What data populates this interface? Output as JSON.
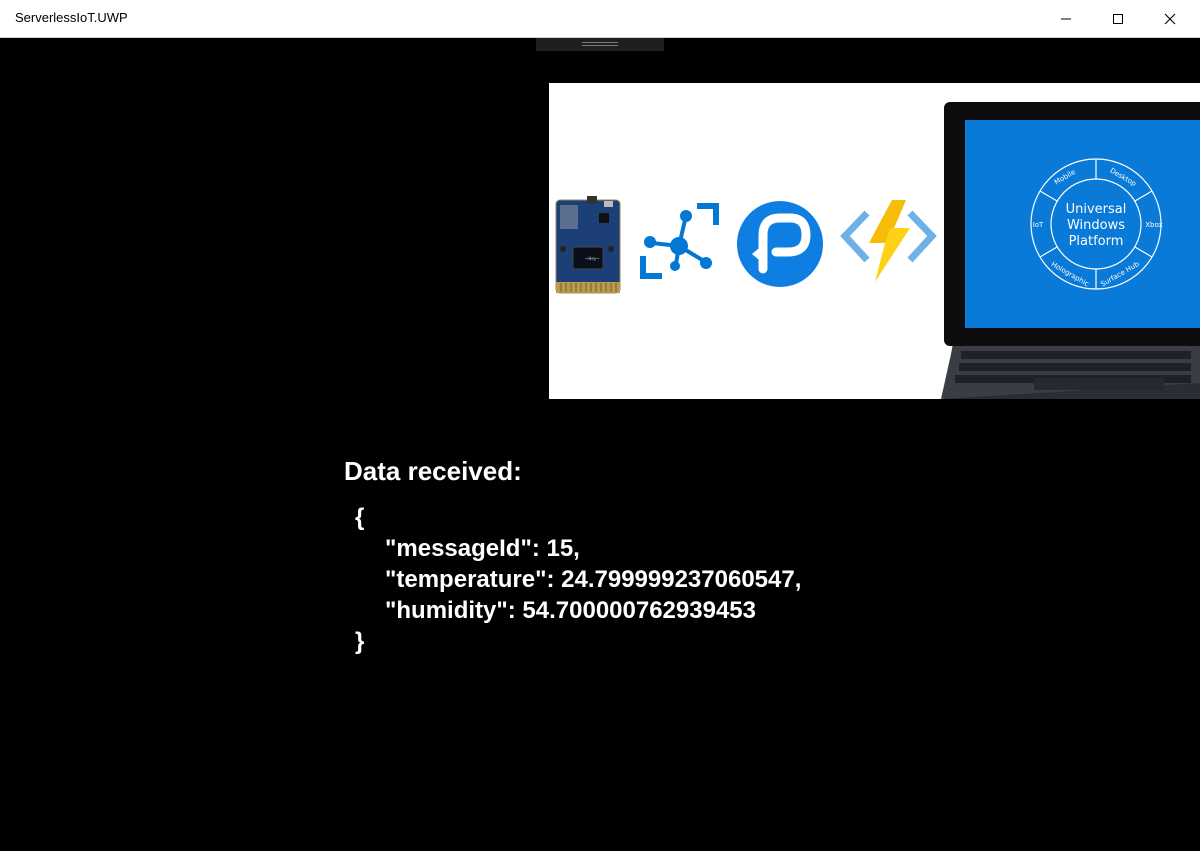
{
  "window": {
    "title": "ServerlessIoT.UWP"
  },
  "banner": {
    "icons": [
      "iot-devkit-board-icon",
      "iot-hub-icon",
      "signalr-icon",
      "azure-functions-icon",
      "surface-laptop-icon"
    ],
    "uwp_center": [
      "Universal",
      "Windows",
      "Platform"
    ],
    "uwp_segments": [
      "Mobile",
      "Desktop",
      "Xbox",
      "Surface Hub",
      "Holographic",
      "IoT"
    ],
    "colors": {
      "azure_blue": "#0078d4",
      "lightning_yellow": "#fcd116",
      "screen_blue": "#0a7ad8"
    }
  },
  "data": {
    "heading": "Data received:",
    "open_brace": "{",
    "lines": [
      "\"messageId\": 15,",
      "\"temperature\": 24.799999237060547,",
      "\"humidity\": 54.700000762939453"
    ],
    "close_brace": "}"
  }
}
